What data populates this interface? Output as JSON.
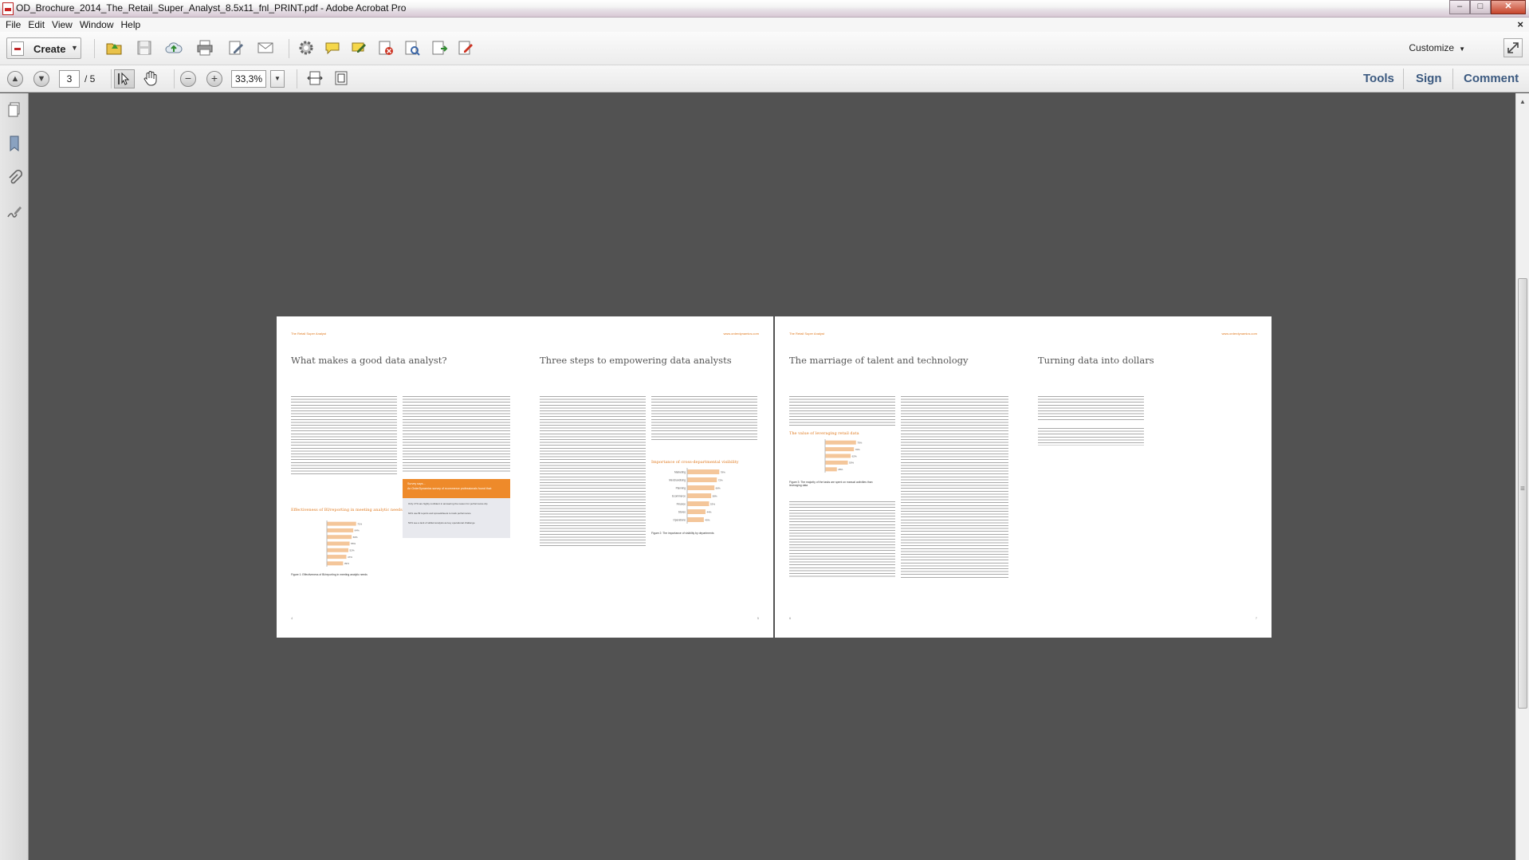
{
  "window": {
    "title": "OD_Brochure_2014_The_Retail_Super_Analyst_8.5x11_fnl_PRINT.pdf - Adobe Acrobat Pro",
    "minimize": "–",
    "maximize": "□",
    "close": "✕"
  },
  "menu": {
    "items": [
      "File",
      "Edit",
      "View",
      "Window",
      "Help"
    ],
    "doc_close": "×"
  },
  "toolbar": {
    "create_label": "Create",
    "customize_label": "Customize",
    "icons": [
      "open-icon",
      "save-icon",
      "upload-cloud-icon",
      "print-icon",
      "edit-document-icon",
      "email-icon",
      "settings-gear-icon",
      "comment-bubble-icon",
      "sign-pen-icon",
      "redact-icon",
      "export-icon",
      "combine-icon",
      "form-icon"
    ]
  },
  "navbar": {
    "current_page": "3",
    "total_pages": "/ 5",
    "zoom": "33,3%",
    "tabs": [
      "Tools",
      "Sign",
      "Comment"
    ]
  },
  "document": {
    "left_page": {
      "header_left": "The Retail Super Analyst",
      "header_right": "www.orderdynamics.com",
      "title_1": "What makes a good data analyst?",
      "title_2": "Three steps to empowering data analysts",
      "chart_1_title": "Effectiveness of BI/reporting in meeting analytic needs",
      "chart_2_title": "Importance of cross-departmental visibility",
      "callout_head": "Survey says...",
      "callout_text": "An OrderDynamics survey of ecommerce professionals found that:",
      "callout_items": [
        "Only 17% are highly confident in answering the reason for performance dip",
        "62% use BI reports and spreadsheets to track performance",
        "52% see a lack of skilled analysts as key operational challenge"
      ],
      "figure_1": "Figure 1: Effectiveness of BI/reporting in meeting analytic needs",
      "figure_2": "Figure 2: The importance of visibility by departments",
      "page_number": "4",
      "page_number_right": "5"
    },
    "right_page": {
      "header_left": "The Retail Super Analyst",
      "header_right": "www.orderdynamics.com",
      "title_1": "The marriage of talent and technology",
      "title_2": "Turning data into dollars",
      "chart_title": "The value of leveraging retail data",
      "figure_3": "Figure 3: The majority of the tasks are spent on manual activities than leveraging data",
      "page_number": "6",
      "page_number_right": "7"
    }
  },
  "chart_data": [
    {
      "type": "bar",
      "title": "Effectiveness of BI/reporting in meeting analytic needs",
      "categories": [
        "",
        "",
        "",
        "",
        "",
        "",
        ""
      ],
      "values": [
        71,
        64,
        60,
        55,
        52,
        47,
        39
      ]
    },
    {
      "type": "bar",
      "title": "Importance of cross-departmental visibility",
      "categories": [
        "Marketing",
        "Merchandising",
        "Planning",
        "Ecommerce",
        "Finance",
        "Stores",
        "Operations"
      ],
      "values": [
        78,
        72,
        66,
        58,
        53,
        44,
        40
      ]
    },
    {
      "type": "bar",
      "title": "The value of leveraging retail data",
      "categories": [
        "",
        "",
        "",
        "",
        ""
      ],
      "values": [
        75,
        70,
        62,
        55,
        28
      ]
    }
  ],
  "colors": {
    "accent": "#e07a20",
    "tab_text": "#3c5a80",
    "doc_background": "#525252"
  }
}
